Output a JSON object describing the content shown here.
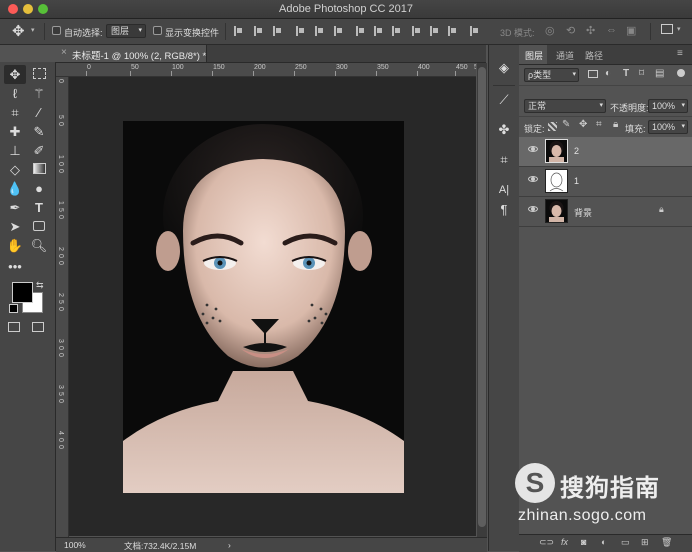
{
  "window": {
    "title": "Adobe Photoshop CC 2017"
  },
  "options_bar": {
    "auto_select_label": "自动选择:",
    "auto_select_value": "图层",
    "show_transform_label": "显示变换控件",
    "mode_3d_label": "3D 模式:"
  },
  "document": {
    "tab_title": "未标题-1 @ 100% (2, RGB/8*) *",
    "tab_close": "×"
  },
  "rulers": {
    "horizontal": [
      "0",
      "50",
      "100",
      "150",
      "200",
      "250",
      "300",
      "350",
      "400",
      "450",
      "500"
    ],
    "vertical": [
      "0",
      "5",
      "0",
      "1",
      "0",
      "0",
      "1",
      "5",
      "0",
      "2",
      "0",
      "0",
      "2",
      "5",
      "0",
      "3",
      "0",
      "0",
      "3",
      "5",
      "0",
      "4",
      "0",
      "0"
    ]
  },
  "status": {
    "zoom": "100%",
    "doc_size": "文档:732.4K/2.15M",
    "arrow": "›"
  },
  "panel": {
    "tabs": [
      "图层",
      "通道",
      "路径"
    ],
    "filter_kind": "ρ类型",
    "blend_mode": "正常",
    "opacity_label": "不透明度:",
    "opacity_value": "100%",
    "lock_label": "锁定:",
    "fill_label": "填充:",
    "fill_value": "100%",
    "layers": [
      {
        "name": "2",
        "visible": true,
        "selected": true
      },
      {
        "name": "1",
        "visible": true,
        "selected": false
      },
      {
        "name": "背景",
        "visible": true,
        "selected": false,
        "locked": true
      }
    ],
    "footer_fx": "fx"
  },
  "watermark": {
    "logo": "S",
    "text": "搜狗指南",
    "url": "zhinan.sogo.com"
  },
  "colors": {
    "foreground": "#000000",
    "background": "#ffffff",
    "ui_dark": "#535353",
    "selected_layer": "#686868"
  }
}
